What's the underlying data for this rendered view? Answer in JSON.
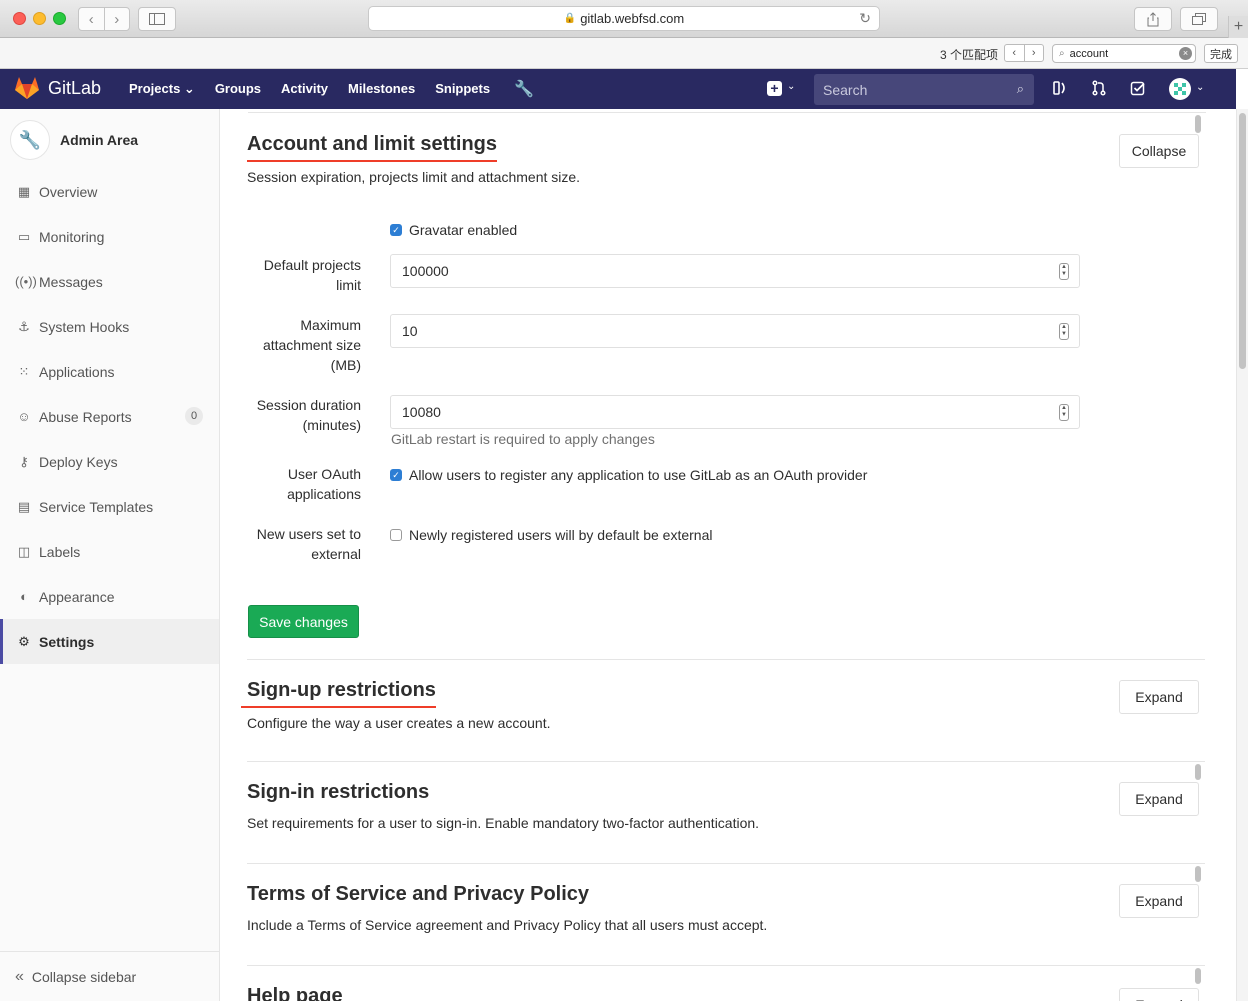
{
  "browser": {
    "url": "gitlab.webfsd.com",
    "find": {
      "count": "3 个匹配项",
      "query": "account",
      "done": "完成"
    }
  },
  "topnav": {
    "brand": "GitLab",
    "links": [
      "Projects ⌄",
      "Groups",
      "Activity",
      "Milestones",
      "Snippets"
    ],
    "search_placeholder": "Search"
  },
  "sidebar": {
    "header": "Admin Area",
    "items": [
      {
        "label": "Overview",
        "icon": "grid-icon"
      },
      {
        "label": "Monitoring",
        "icon": "monitor-icon"
      },
      {
        "label": "Messages",
        "icon": "broadcast-icon"
      },
      {
        "label": "System Hooks",
        "icon": "hook-icon"
      },
      {
        "label": "Applications",
        "icon": "apps-icon"
      },
      {
        "label": "Abuse Reports",
        "icon": "abuse-icon",
        "count": "0"
      },
      {
        "label": "Deploy Keys",
        "icon": "key-icon"
      },
      {
        "label": "Service Templates",
        "icon": "template-icon"
      },
      {
        "label": "Labels",
        "icon": "label-icon"
      },
      {
        "label": "Appearance",
        "icon": "palette-icon"
      },
      {
        "label": "Settings",
        "icon": "gear-icon",
        "active": true
      }
    ],
    "collapse_label": "Collapse sidebar"
  },
  "account_section": {
    "title": "Account and limit settings",
    "description": "Session expiration, projects limit and attachment size.",
    "button": "Collapse",
    "gravatar_label": "Gravatar enabled",
    "gravatar_checked": true,
    "fields": {
      "projects_limit": {
        "label_1": "Default projects",
        "label_2": "limit",
        "value": "100000"
      },
      "attachment_size": {
        "label_1": "Maximum",
        "label_2": "attachment size",
        "label_3": "(MB)",
        "value": "10"
      },
      "session_duration": {
        "label_1": "Session duration",
        "label_2": "(minutes)",
        "value": "10080",
        "help": "GitLab restart is required to apply changes"
      }
    },
    "oauth": {
      "label_1": "User OAuth",
      "label_2": "applications",
      "text": "Allow users to register any application to use GitLab as an OAuth provider",
      "checked": true
    },
    "external": {
      "label_1": "New users set to",
      "label_2": "external",
      "text": "Newly registered users will by default be external",
      "checked": false
    },
    "save_button": "Save changes"
  },
  "collapsed_sections": [
    {
      "title": "Sign-up restrictions",
      "description": "Configure the way a user creates a new account.",
      "button": "Expand"
    },
    {
      "title": "Sign-in restrictions",
      "description": "Set requirements for a user to sign-in. Enable mandatory two-factor authentication.",
      "button": "Expand"
    },
    {
      "title": "Terms of Service and Privacy Policy",
      "description": "Include a Terms of Service agreement and Privacy Policy that all users must accept.",
      "button": "Expand"
    },
    {
      "title": "Help page",
      "description": "",
      "button": "Expand"
    }
  ],
  "colors": {
    "nav": "#292961",
    "accent": "#ef3d29",
    "save": "#1aaa55"
  }
}
